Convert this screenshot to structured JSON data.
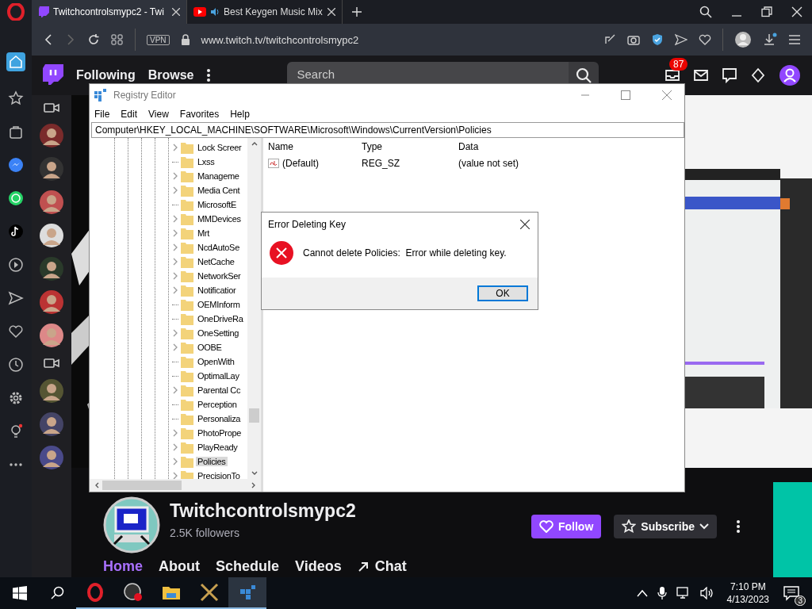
{
  "browser": {
    "tabs": [
      {
        "title": "Twitchcontrolsmypc2 - Twi",
        "kind": "twitch",
        "audio": false,
        "selected": true
      },
      {
        "title": "Best Keygen Music Mix",
        "kind": "youtube",
        "audio": true,
        "selected": false
      }
    ],
    "vpn_label": "VPN",
    "address": "www.twitch.tv/twitchcontrolsmypc2"
  },
  "twitch": {
    "nav": [
      "Following",
      "Browse"
    ],
    "search": {
      "placeholder": "Search"
    },
    "notification_count": "87",
    "channel": {
      "name": "Twitchcontrolsmypc2",
      "followers": "2.5K followers",
      "follow": "Follow",
      "subscribe": "Subscribe"
    },
    "tabs": [
      {
        "label": "Home",
        "selected": true
      },
      {
        "label": "About",
        "selected": false
      },
      {
        "label": "Schedule",
        "selected": false
      },
      {
        "label": "Videos",
        "selected": false
      },
      {
        "label": "Chat",
        "selected": false,
        "kind": "popout"
      }
    ]
  },
  "registry_editor": {
    "title": "Registry Editor",
    "menu": [
      "File",
      "Edit",
      "View",
      "Favorites",
      "Help"
    ],
    "path": "Computer\\HKEY_LOCAL_MACHINE\\SOFTWARE\\Microsoft\\Windows\\CurrentVersion\\Policies",
    "tree_items": [
      {
        "name": "Lock Screer",
        "expandable": true,
        "selected": false
      },
      {
        "name": "Lxss",
        "expandable": false,
        "selected": false
      },
      {
        "name": "Manageme",
        "expandable": true,
        "selected": false
      },
      {
        "name": "Media Cent",
        "expandable": true,
        "selected": false
      },
      {
        "name": "MicrosoftE",
        "expandable": false,
        "selected": false
      },
      {
        "name": "MMDevices",
        "expandable": true,
        "selected": false
      },
      {
        "name": "Mrt",
        "expandable": true,
        "selected": false
      },
      {
        "name": "NcdAutoSe",
        "expandable": true,
        "selected": false
      },
      {
        "name": "NetCache",
        "expandable": true,
        "selected": false
      },
      {
        "name": "NetworkSer",
        "expandable": true,
        "selected": false
      },
      {
        "name": "Notificatior",
        "expandable": true,
        "selected": false
      },
      {
        "name": "OEMInform",
        "expandable": false,
        "selected": false
      },
      {
        "name": "OneDriveRa",
        "expandable": false,
        "selected": false
      },
      {
        "name": "OneSetting",
        "expandable": true,
        "selected": false
      },
      {
        "name": "OOBE",
        "expandable": true,
        "selected": false
      },
      {
        "name": "OpenWith",
        "expandable": false,
        "selected": false
      },
      {
        "name": "OptimalLay",
        "expandable": false,
        "selected": false
      },
      {
        "name": "Parental Cc",
        "expandable": true,
        "selected": false
      },
      {
        "name": "Perception",
        "expandable": false,
        "selected": false
      },
      {
        "name": "Personaliza",
        "expandable": false,
        "selected": false
      },
      {
        "name": "PhotoPrope",
        "expandable": true,
        "selected": false
      },
      {
        "name": "PlayReady",
        "expandable": true,
        "selected": false
      },
      {
        "name": "Policies",
        "expandable": true,
        "selected": true
      },
      {
        "name": "PrecisionTo",
        "expandable": true,
        "selected": false
      }
    ],
    "columns": [
      "Name",
      "Type",
      "Data"
    ],
    "values": [
      {
        "name": "(Default)",
        "type": "REG_SZ",
        "data": "(value not set)"
      }
    ]
  },
  "dialog": {
    "title": "Error Deleting Key",
    "message": "Cannot delete Policies:  Error while deleting key.",
    "button": "OK"
  },
  "taskbar": {
    "apps": [
      {
        "kind": "opera",
        "selected": false
      },
      {
        "kind": "recorder",
        "selected": false
      },
      {
        "kind": "folder",
        "selected": false
      },
      {
        "kind": "swords",
        "selected": false
      },
      {
        "kind": "registry",
        "selected": true
      }
    ],
    "time": "7:10 PM",
    "date": "4/13/2023",
    "notification_count": "3"
  }
}
